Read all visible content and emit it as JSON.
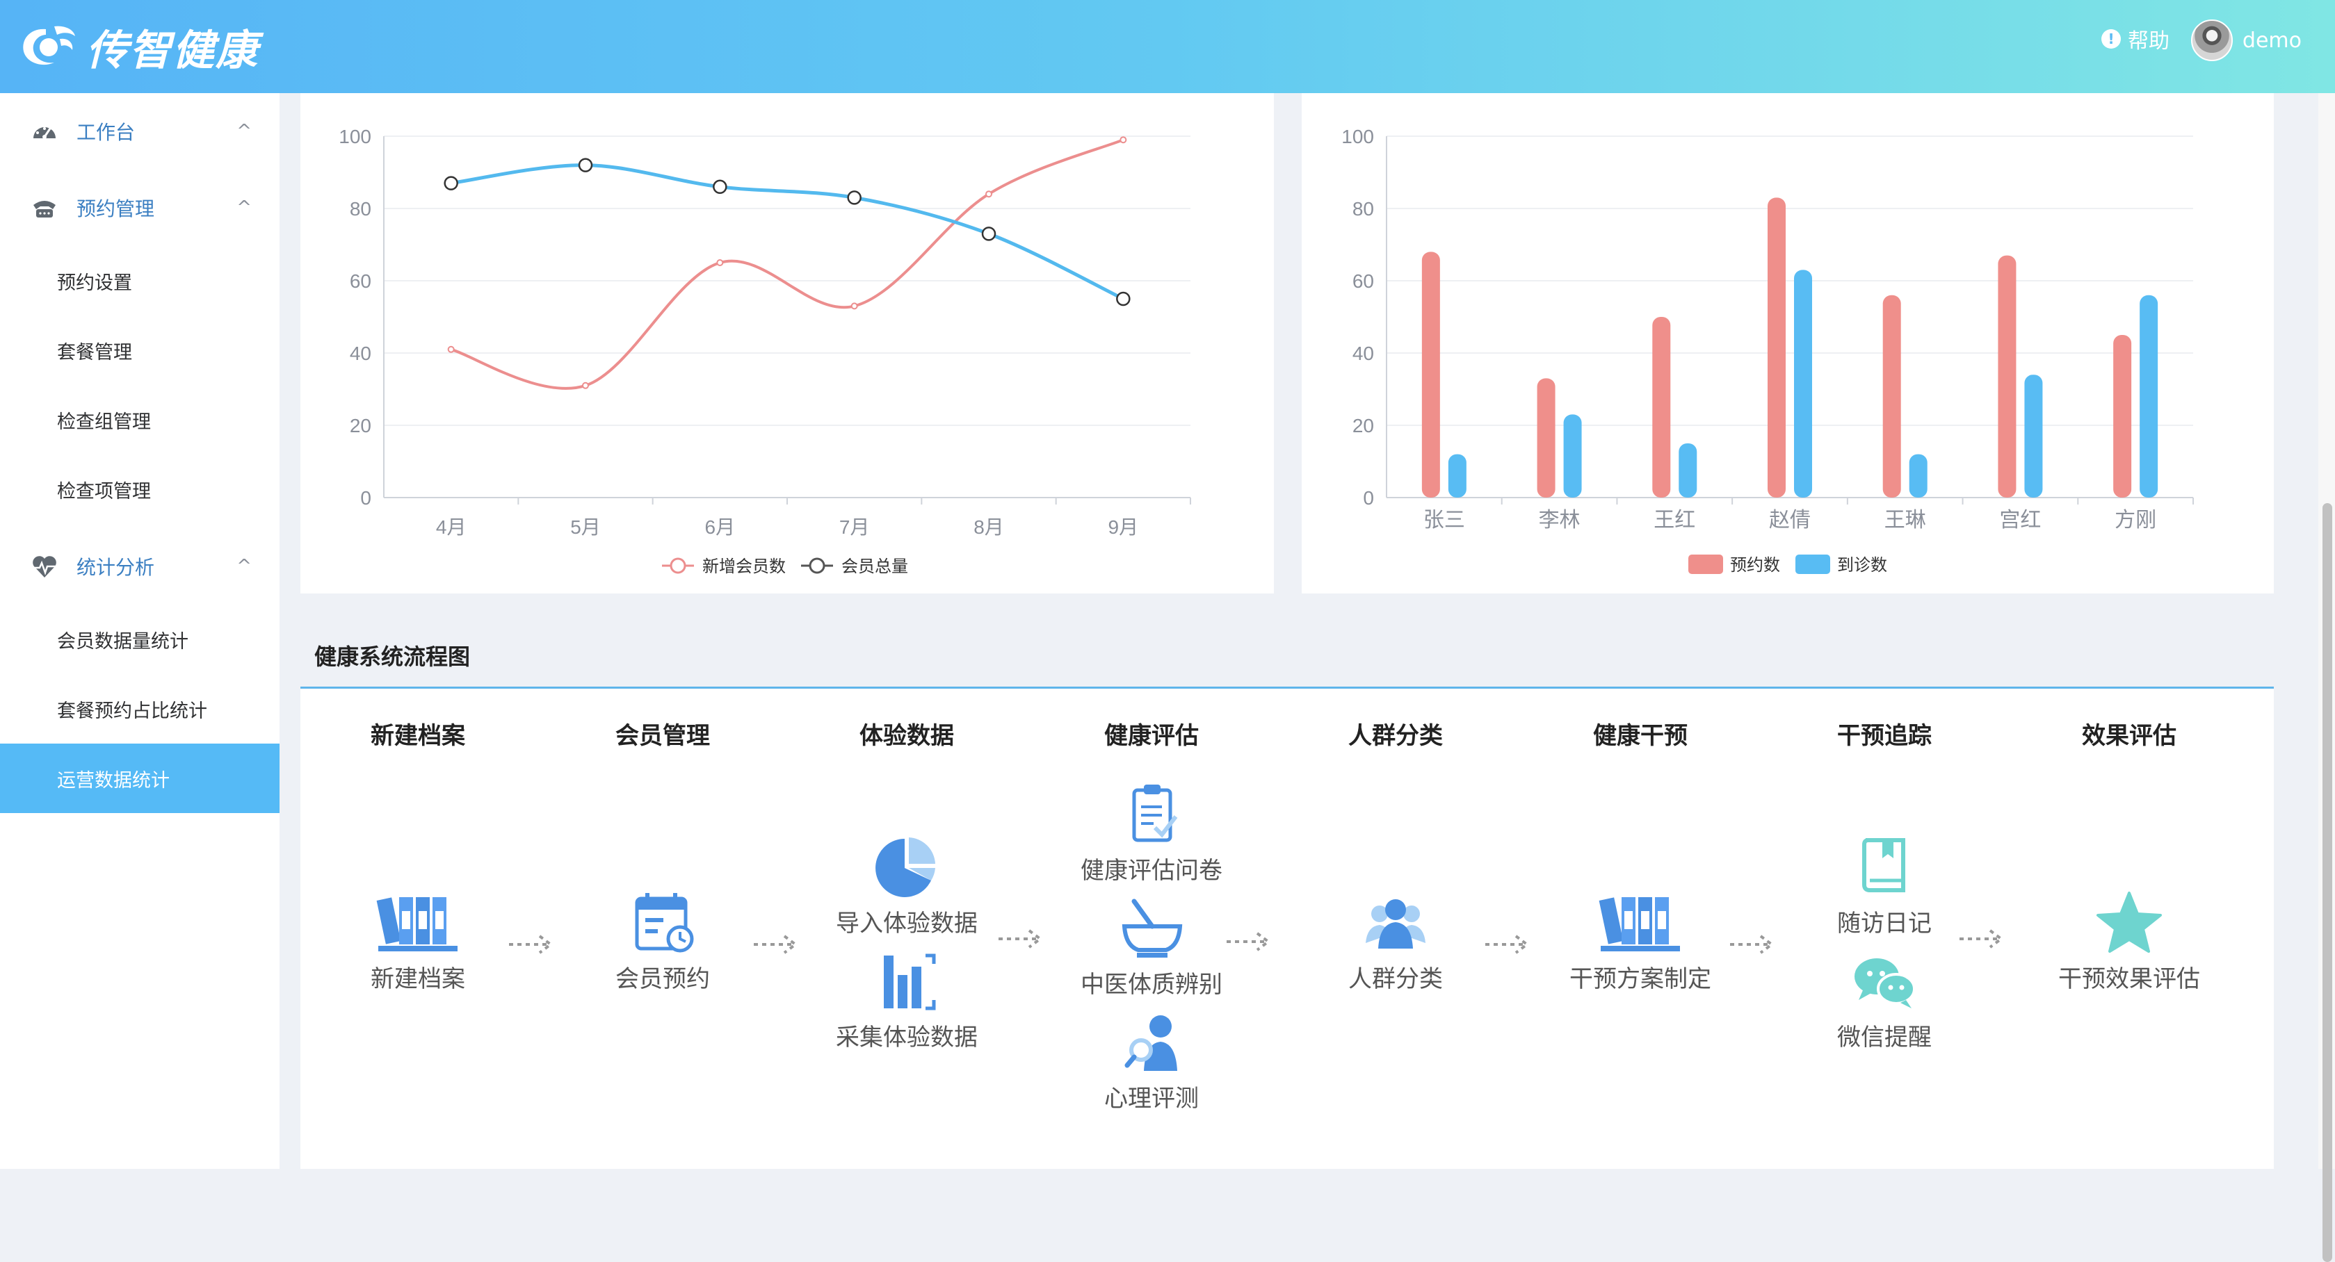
{
  "header": {
    "logo_text": "传智健康",
    "help_label": "帮助",
    "help_icon": "!",
    "username": "demo"
  },
  "sidebar": {
    "menus": [
      {
        "label": "工作台",
        "icon": "dashboard-icon",
        "arrow": "^"
      },
      {
        "label": "预约管理",
        "icon": "phone-icon",
        "arrow": "^"
      },
      {
        "label": "统计分析",
        "icon": "heartbeat-icon",
        "arrow": "^"
      }
    ],
    "subitems": [
      {
        "label": "预约设置"
      },
      {
        "label": "套餐管理"
      },
      {
        "label": "检查组管理"
      },
      {
        "label": "检查项管理"
      },
      {
        "label": "会员数据量统计"
      },
      {
        "label": "套餐预约占比统计"
      },
      {
        "label": "运营数据统计",
        "active": true
      }
    ]
  },
  "chart_data": [
    {
      "type": "line",
      "categories": [
        "4月",
        "5月",
        "6月",
        "7月",
        "8月",
        "9月"
      ],
      "ylim": [
        0,
        100
      ],
      "yticks": [
        "0",
        "20",
        "40",
        "60",
        "80",
        "100"
      ],
      "grid": true,
      "legend_position": "bottom",
      "series": [
        {
          "name": "新增会员数",
          "values": [
            41,
            31,
            65,
            53,
            84,
            99
          ],
          "color": "#ec8e8e",
          "smooth": true
        },
        {
          "name": "会员总量",
          "values": [
            87,
            92,
            86,
            83,
            73,
            55
          ],
          "color": "#53b9ee",
          "smooth": true
        }
      ]
    },
    {
      "type": "bar",
      "categories": [
        "张三",
        "李林",
        "王红",
        "赵倩",
        "王琳",
        "宫红",
        "方刚"
      ],
      "ylim": [
        0,
        100
      ],
      "yticks": [
        "0",
        "20",
        "40",
        "60",
        "80",
        "100"
      ],
      "grid": true,
      "legend_position": "bottom",
      "series": [
        {
          "name": "预约数",
          "values": [
            68,
            33,
            50,
            83,
            56,
            67,
            45
          ],
          "color": "#ef8f8b"
        },
        {
          "name": "到诊数",
          "values": [
            12,
            23,
            15,
            63,
            12,
            34,
            56
          ],
          "color": "#58bcf3"
        }
      ]
    }
  ],
  "flow": {
    "title": "健康系统流程图",
    "stages": [
      {
        "title": "新建档案",
        "nodes": [
          {
            "label": "新建档案",
            "icon": "archive-binders-icon"
          }
        ]
      },
      {
        "title": "会员管理",
        "nodes": [
          {
            "label": "会员预约",
            "icon": "calendar-clock-icon"
          }
        ]
      },
      {
        "title": "体验数据",
        "nodes": [
          {
            "label": "导入体验数据",
            "icon": "pie-chart-icon"
          },
          {
            "label": "采集体验数据",
            "icon": "bar-chart-icon"
          }
        ]
      },
      {
        "title": "健康评估",
        "nodes": [
          {
            "label": "健康评估问卷",
            "icon": "clipboard-icon"
          },
          {
            "label": "中医体质辨别",
            "icon": "mortar-icon"
          },
          {
            "label": "心理评测",
            "icon": "person-search-icon"
          }
        ]
      },
      {
        "title": "人群分类",
        "nodes": [
          {
            "label": "人群分类",
            "icon": "people-group-icon"
          }
        ]
      },
      {
        "title": "健康干预",
        "nodes": [
          {
            "label": "干预方案制定",
            "icon": "archive-binders-icon"
          }
        ]
      },
      {
        "title": "干预追踪",
        "nodes": [
          {
            "label": "随访日记",
            "icon": "book-icon"
          },
          {
            "label": "微信提醒",
            "icon": "wechat-icon"
          }
        ]
      },
      {
        "title": "效果评估",
        "nodes": [
          {
            "label": "干预效果评估",
            "icon": "star-icon"
          }
        ]
      }
    ]
  }
}
